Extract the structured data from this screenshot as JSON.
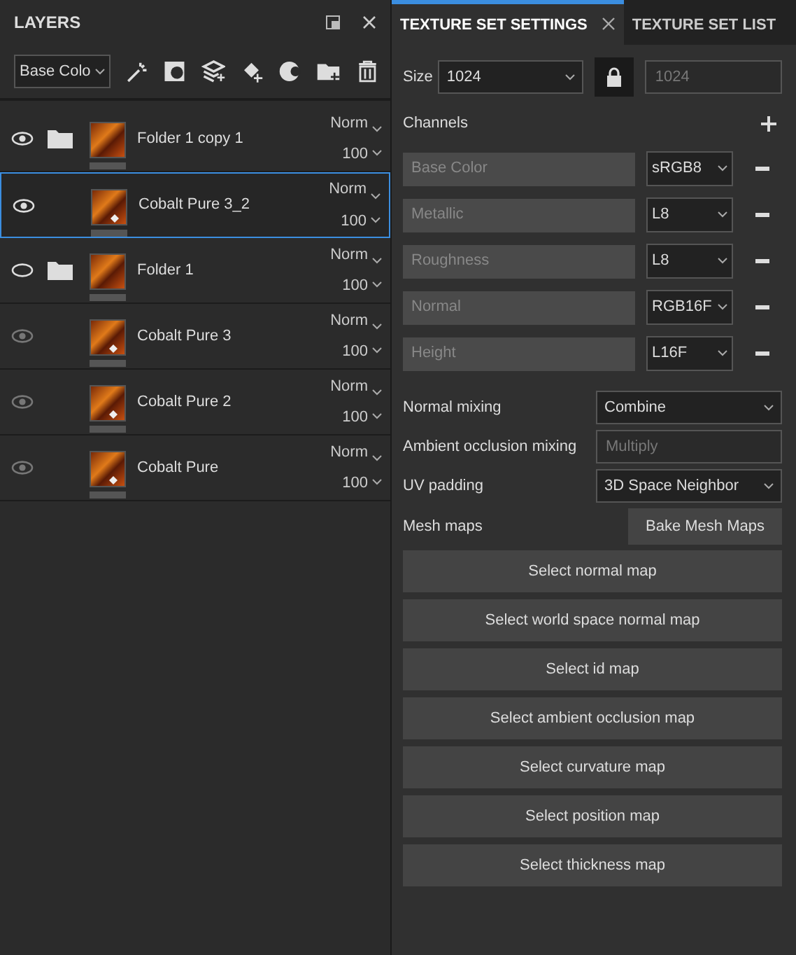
{
  "layers_panel": {
    "title": "LAYERS",
    "channel_select": "Base Colo",
    "layers": [
      {
        "kind": "folder",
        "name": "Folder 1 copy 1",
        "visible": true,
        "dimmed": false,
        "selected": false,
        "blend": "Norm",
        "opacity": "100",
        "children": [
          {
            "kind": "fill",
            "name": "Cobalt Pure 3_2",
            "visible": true,
            "dimmed": false,
            "selected": true,
            "blend": "Norm",
            "opacity": "100"
          }
        ]
      },
      {
        "kind": "folder",
        "name": "Folder 1",
        "visible": false,
        "dimmed": false,
        "selected": false,
        "blend": "Norm",
        "opacity": "100",
        "children": [
          {
            "kind": "fill",
            "name": "Cobalt Pure 3",
            "visible": true,
            "dimmed": true,
            "selected": false,
            "blend": "Norm",
            "opacity": "100"
          },
          {
            "kind": "fill",
            "name": "Cobalt Pure 2",
            "visible": true,
            "dimmed": true,
            "selected": false,
            "blend": "Norm",
            "opacity": "100"
          },
          {
            "kind": "fill",
            "name": "Cobalt Pure",
            "visible": true,
            "dimmed": true,
            "selected": false,
            "blend": "Norm",
            "opacity": "100"
          }
        ]
      }
    ]
  },
  "tabs": [
    {
      "label": "TEXTURE SET SETTINGS",
      "selected": true
    },
    {
      "label": "TEXTURE SET LIST",
      "selected": false
    }
  ],
  "size": {
    "label": "Size",
    "value": "1024",
    "locked": true,
    "linked_value": "1024"
  },
  "channels": {
    "label": "Channels",
    "items": [
      {
        "name": "Base Color",
        "format": "sRGB8"
      },
      {
        "name": "Metallic",
        "format": "L8"
      },
      {
        "name": "Roughness",
        "format": "L8"
      },
      {
        "name": "Normal",
        "format": "RGB16F"
      },
      {
        "name": "Height",
        "format": "L16F"
      }
    ]
  },
  "settings": [
    {
      "label": "Normal mixing",
      "value": "Combine",
      "disabled": false
    },
    {
      "label": "Ambient occlusion mixing",
      "value": "Multiply",
      "disabled": true
    },
    {
      "label": "UV padding",
      "value": "3D Space Neighbor",
      "disabled": false
    }
  ],
  "mesh_maps": {
    "label": "Mesh maps",
    "bake_button": "Bake Mesh Maps",
    "buttons": [
      "Select normal map",
      "Select world space normal map",
      "Select id map",
      "Select ambient occlusion map",
      "Select curvature map",
      "Select position map",
      "Select thickness map"
    ]
  }
}
